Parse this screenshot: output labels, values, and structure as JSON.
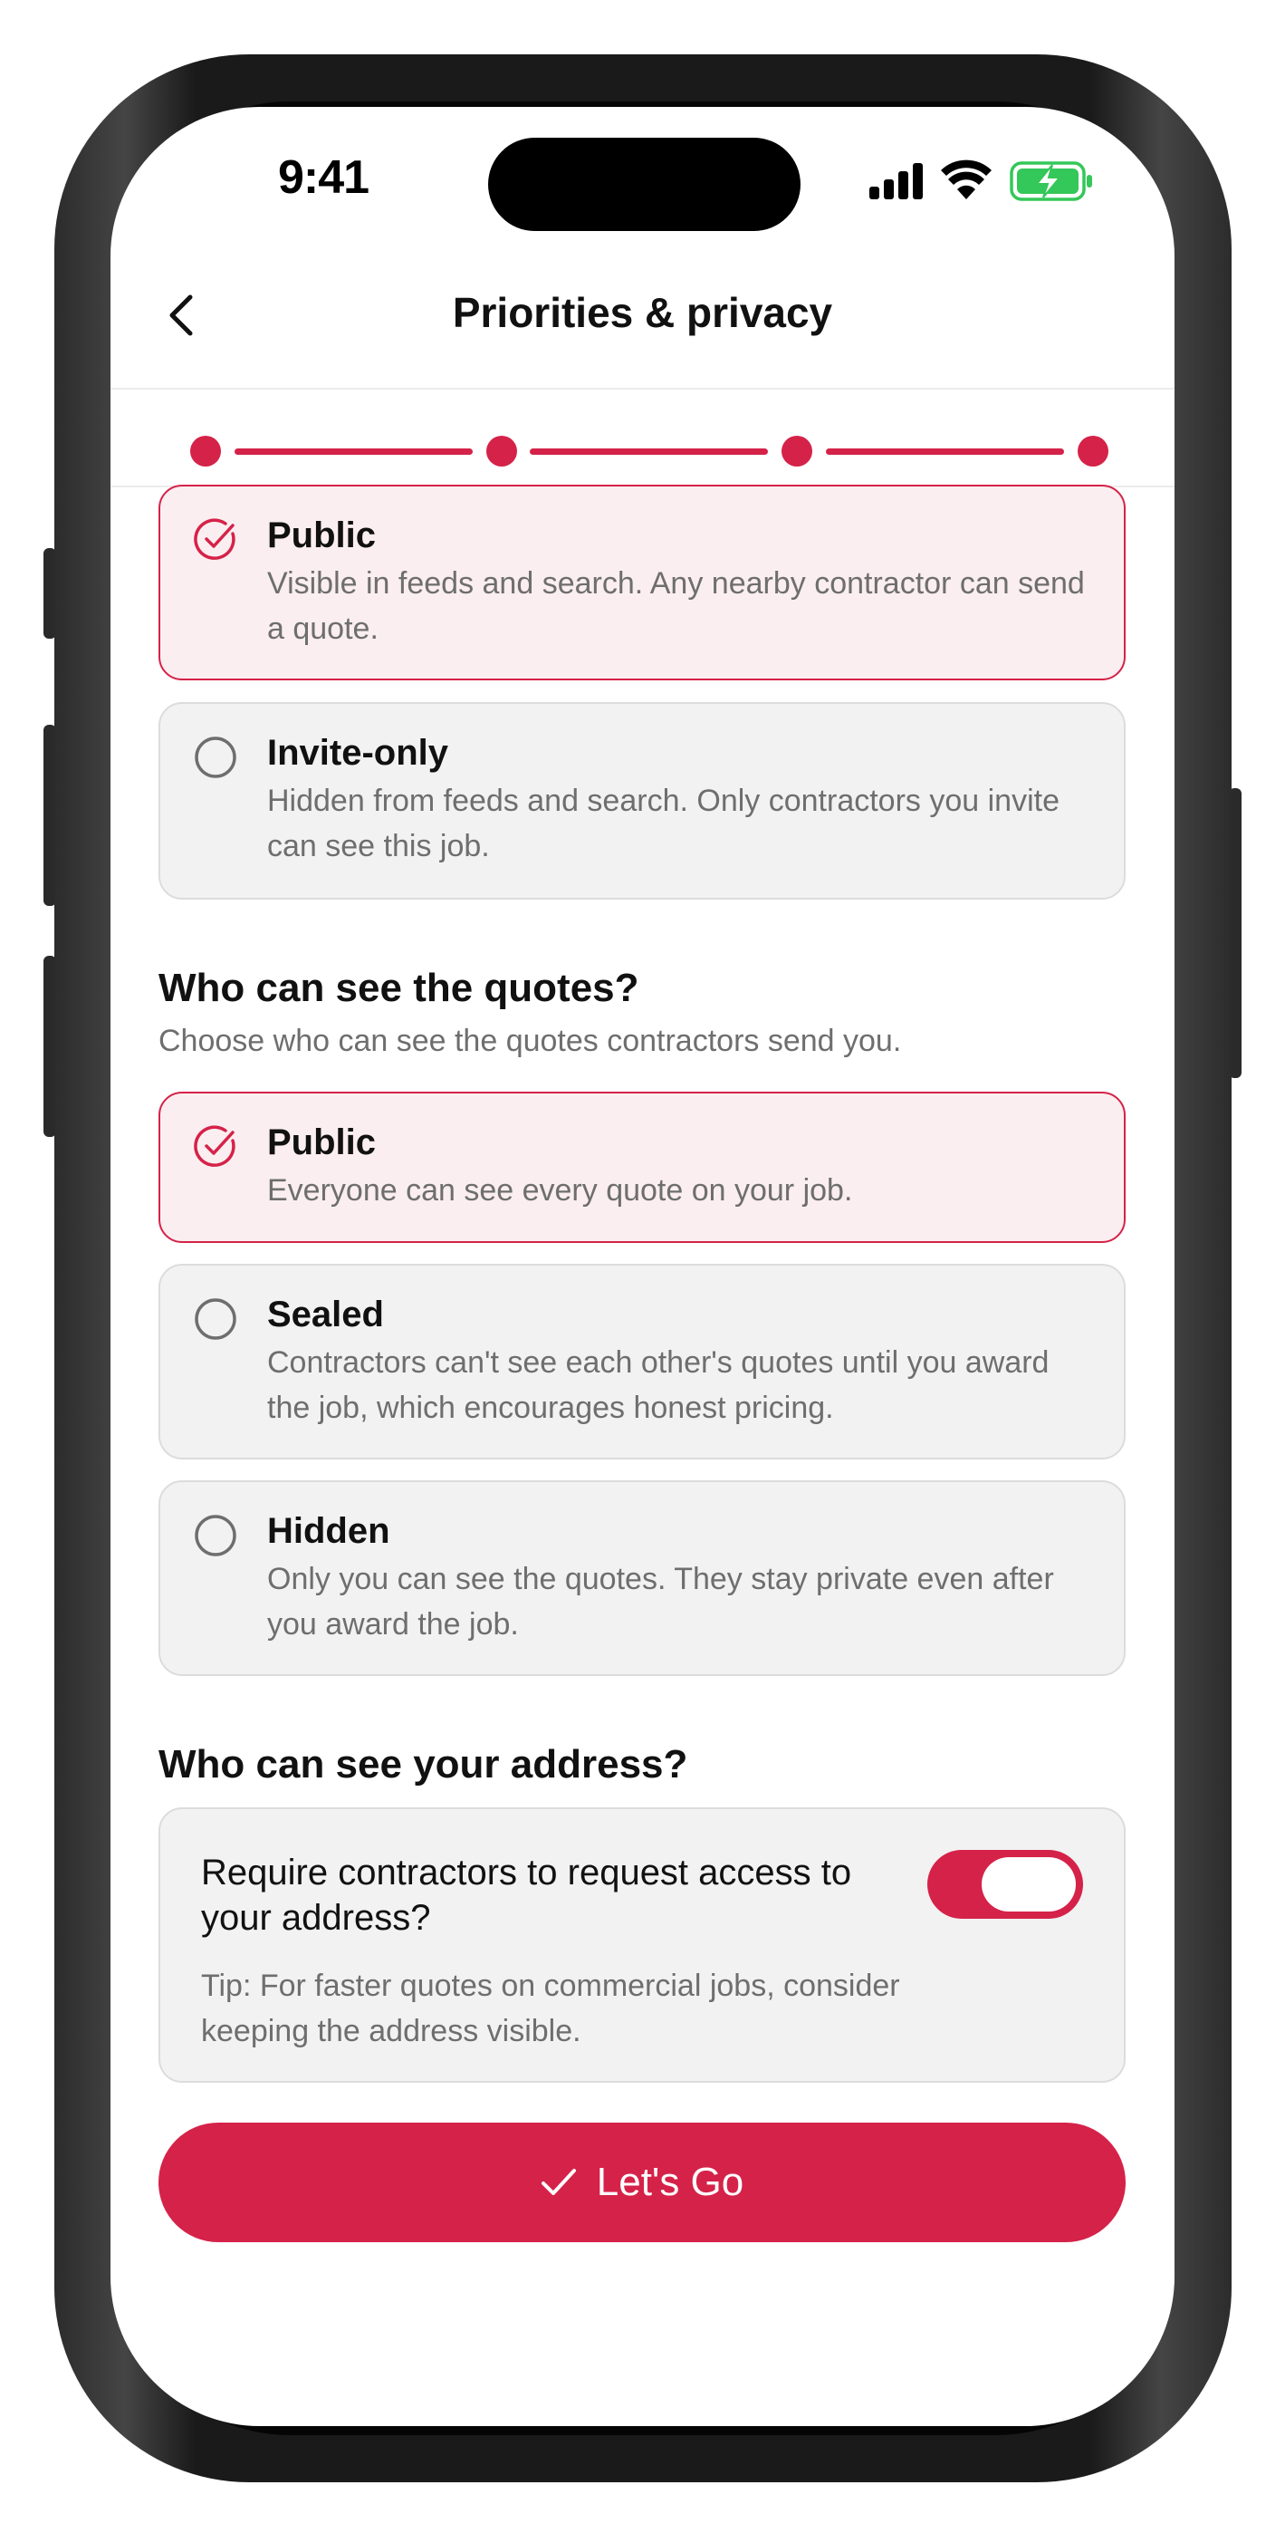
{
  "status_bar": {
    "time": "9:41"
  },
  "header": {
    "title": "Priorities & privacy"
  },
  "stepper": {
    "total_steps": 4,
    "completed_steps": 4
  },
  "job_visibility": {
    "options": [
      {
        "title": "Public",
        "description": "Visible in feeds and search. Any nearby contractor can send a quote.",
        "selected": true
      },
      {
        "title": "Invite-only",
        "description": "Hidden from feeds and search. Only contractors you invite can see this job.",
        "selected": false
      }
    ]
  },
  "quotes_visibility": {
    "heading": "Who can see the quotes?",
    "subtitle": "Choose who can see the quotes contractors send you.",
    "options": [
      {
        "title": "Public",
        "description": "Everyone can see every quote on your job.",
        "selected": true
      },
      {
        "title": "Sealed",
        "description": "Contractors can't see each other's quotes until you award the job, which encourages honest pricing.",
        "selected": false
      },
      {
        "title": "Hidden",
        "description": "Only you can see the quotes. They stay private even after you award the job.",
        "selected": false
      }
    ]
  },
  "address": {
    "heading": "Who can see your address?",
    "question": "Require contractors to request access to your address?",
    "tip": "Tip: For faster quotes on commercial jobs, consider keeping the address visible.",
    "toggle_on": true
  },
  "cta": {
    "label": "Let's Go",
    "icon": "check-icon"
  },
  "colors": {
    "accent": "#d52249",
    "selected_bg": "#fbeef0",
    "card_bg": "#f2f2f2",
    "muted_text": "#6e6e6e"
  },
  "icons": [
    "back-chevron-icon",
    "signal-icon",
    "wifi-icon",
    "battery-charging-icon",
    "check-circle-icon",
    "radio-empty-icon",
    "check-icon"
  ]
}
